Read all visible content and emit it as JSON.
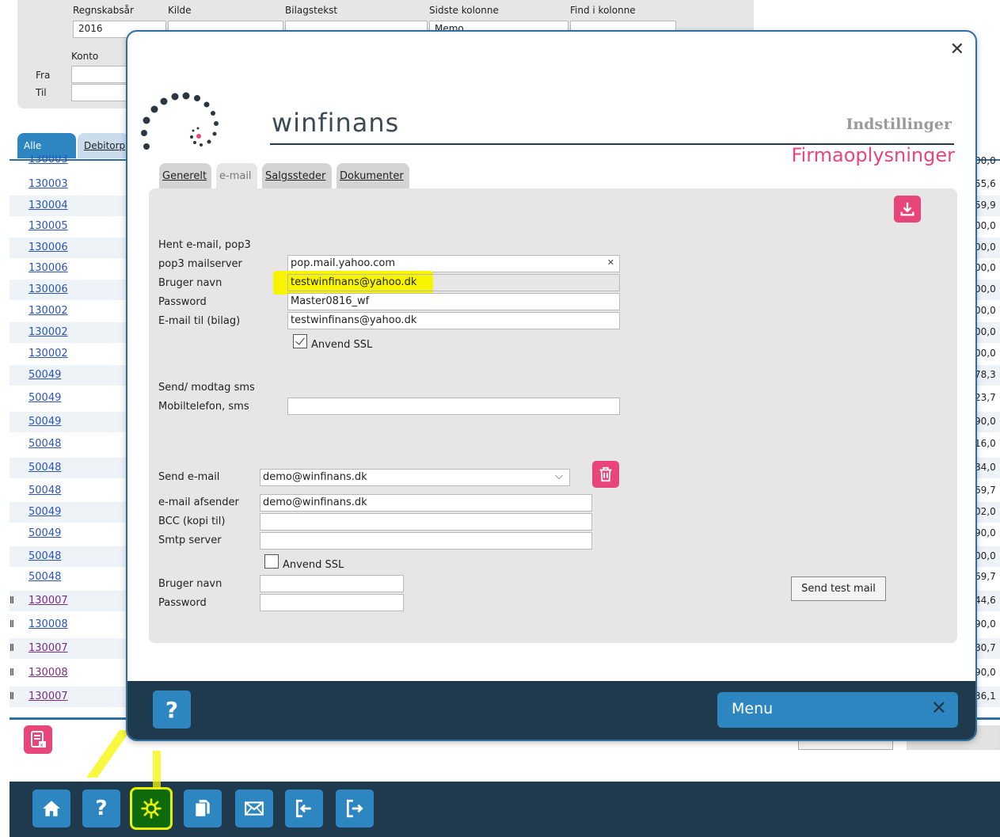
{
  "filters": {
    "regnskabsar_label": "Regnskabsår",
    "regnskabsar_value": "2016",
    "kilde_label": "Kilde",
    "bilagstekst_label": "Bilagstekst",
    "sidste_kolonne_label": "Sidste kolonne",
    "sidste_kolonne_value": "Memo",
    "find_label": "Find i kolonne",
    "konto_label": "Konto",
    "fra_label": "Fra",
    "til_label": "Til"
  },
  "list_tabs": [
    "Alle",
    "Debitorp"
  ],
  "rows": [
    {
      "id": "130003",
      "clip": false,
      "visited": false,
      "right": "55,6"
    },
    {
      "id": "130004",
      "clip": false,
      "visited": false,
      "right": "59,9"
    },
    {
      "id": "130005",
      "clip": false,
      "visited": false,
      "right": "00,0"
    },
    {
      "id": "130006",
      "clip": false,
      "visited": false,
      "right": "00,0"
    },
    {
      "id": "130006",
      "clip": false,
      "visited": false,
      "right": "00,0"
    },
    {
      "id": "130006",
      "clip": false,
      "visited": false,
      "right": "00,0"
    },
    {
      "id": "130002",
      "clip": false,
      "visited": false,
      "right": "00,0"
    },
    {
      "id": "130002",
      "clip": false,
      "visited": false,
      "right": "00,0"
    },
    {
      "id": "130002",
      "clip": false,
      "visited": false,
      "right": "00,0"
    },
    {
      "id": "50049",
      "clip": false,
      "visited": false,
      "right": "78,3"
    },
    {
      "id": "50049",
      "clip": false,
      "visited": false,
      "right": "23,7"
    },
    {
      "id": "50049",
      "clip": false,
      "visited": false,
      "right": "90,0"
    },
    {
      "id": "50048",
      "clip": false,
      "visited": false,
      "right": "16,0"
    },
    {
      "id": "50048",
      "clip": false,
      "visited": false,
      "right": "84,0"
    },
    {
      "id": "50048",
      "clip": false,
      "visited": false,
      "right": "69,7"
    },
    {
      "id": "50049",
      "clip": false,
      "visited": false,
      "right": "02,0"
    },
    {
      "id": "50049",
      "clip": false,
      "visited": false,
      "right": "90,0"
    },
    {
      "id": "50048",
      "clip": false,
      "visited": false,
      "right": "00,0"
    },
    {
      "id": "50048",
      "clip": false,
      "visited": false,
      "right": "69,7"
    },
    {
      "id": "130007",
      "clip": true,
      "visited": true,
      "right": "44,6"
    },
    {
      "id": "130008",
      "clip": true,
      "visited": false,
      "right": "90,0"
    },
    {
      "id": "130007",
      "clip": true,
      "visited": true,
      "right": "80,7"
    },
    {
      "id": "130008",
      "clip": true,
      "visited": true,
      "right": "90,0"
    },
    {
      "id": "130007",
      "clip": true,
      "visited": true,
      "right": "36,1"
    }
  ],
  "partial_row_id": "130003",
  "partial_right": "00,0",
  "dialog": {
    "logo_text": "winfinans",
    "subtitle": "Indstillinger",
    "title": "Firmaoplysninger",
    "tabs": [
      "Generelt",
      "e-mail",
      "Salgssteder",
      "Dokumenter"
    ],
    "active_tab": "e-mail",
    "pop3": {
      "section_label": "Hent e-mail, pop3",
      "server_label": "pop3 mailserver",
      "server_value": "pop.mail.yahoo.com",
      "user_label": "Bruger navn",
      "user_value": "testwinfinans@yahoo.dk",
      "password_label": "Password",
      "password_value": "Master0816_wf",
      "mailto_label": "E-mail til (bilag)",
      "mailto_value": "testwinfinans@yahoo.dk",
      "ssl_label": "Anvend SSL",
      "ssl_checked": true
    },
    "sms": {
      "section_label": "Send/ modtag sms",
      "mobile_label": "Mobiltelefon, sms",
      "mobile_value": ""
    },
    "smtp": {
      "send_label": "Send e-mail",
      "send_value": "demo@winfinans.dk",
      "sender_label": "e-mail afsender",
      "sender_value": "demo@winfinans.dk",
      "bcc_label": "BCC (kopi til)",
      "bcc_value": "",
      "server_label": "Smtp server",
      "server_value": "",
      "ssl_label": "Anvend SSL",
      "ssl_checked": false,
      "user_label": "Bruger navn",
      "user_value": "",
      "password_label": "Password",
      "password_value": "",
      "test_button": "Send test mail"
    },
    "help_label": "?",
    "menu_label": "Menu",
    "close_symbol": "✕"
  },
  "footer": {
    "help_label": "?"
  },
  "colors": {
    "accent_blue": "#2e86c1",
    "dark_navy": "#1f3a4d",
    "brand_pink": "#e8457a",
    "highlight_yellow": "#f8f400"
  }
}
